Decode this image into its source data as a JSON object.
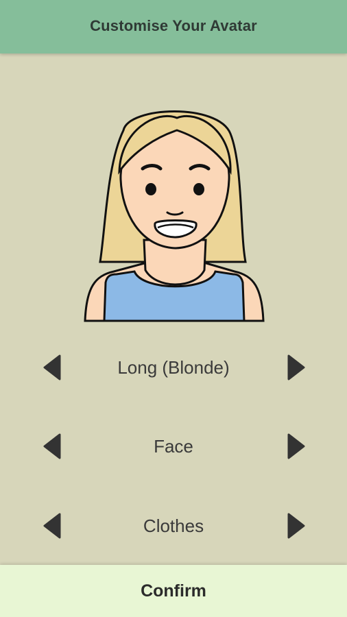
{
  "header": {
    "title": "Customise Your Avatar"
  },
  "avatar": {
    "hair_color": "#ecd597",
    "skin_color": "#fbd7b8",
    "shirt_color": "#8cb9e6"
  },
  "selectors": [
    {
      "label": "Long (Blonde)",
      "prev_icon": "triangle-left-icon",
      "next_icon": "triangle-right-icon"
    },
    {
      "label": "Face",
      "prev_icon": "triangle-left-icon",
      "next_icon": "triangle-right-icon"
    },
    {
      "label": "Clothes",
      "prev_icon": "triangle-left-icon",
      "next_icon": "triangle-right-icon"
    }
  ],
  "confirm": {
    "label": "Confirm"
  },
  "colors": {
    "header_bg": "#85be9a",
    "page_bg": "#d7d6ba",
    "confirm_bg": "#e8f6d4",
    "arrow": "#333333"
  }
}
